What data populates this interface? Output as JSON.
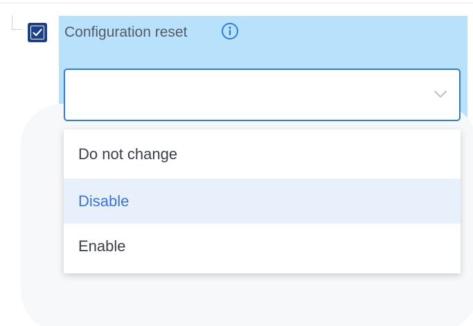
{
  "setting": {
    "checked": true,
    "title": "Configuration reset",
    "info_icon": "info-icon",
    "select_value": "",
    "chevron_icon": "chevron-down-icon"
  },
  "dropdown": {
    "options": [
      {
        "label": "Do not change",
        "highlighted": false
      },
      {
        "label": "Disable",
        "highlighted": true
      },
      {
        "label": "Enable",
        "highlighted": false
      }
    ]
  },
  "colors": {
    "panel_bg": "#b8e2fb",
    "accent": "#2d7de0",
    "checkbox": "#1a3f8f",
    "highlight_text": "#3b73d8",
    "highlight_bg": "#e8f0fb"
  }
}
